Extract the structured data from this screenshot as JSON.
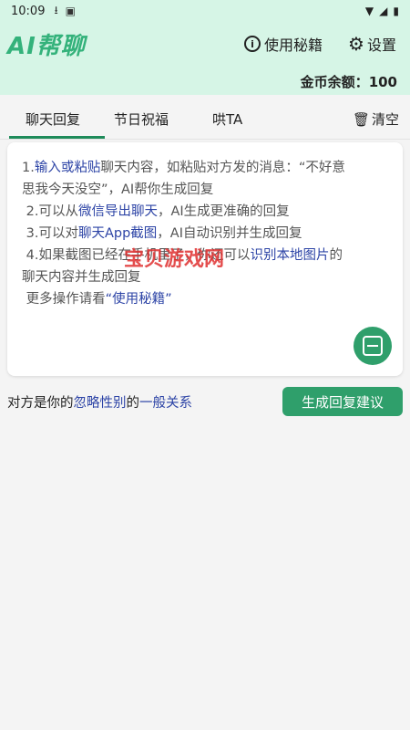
{
  "status_bar": {
    "time": "10:09",
    "icons": [
      "download-icon",
      "font-app-icon",
      "wifi-icon",
      "cellular-icon",
      "battery-icon"
    ]
  },
  "header": {
    "logo": "AI帮聊",
    "help_label": "使用秘籍",
    "settings_label": "设置",
    "coins_label": "金币余额：",
    "coins_value": "100"
  },
  "tabs": {
    "items": [
      {
        "label": "聊天回复"
      },
      {
        "label": "节日祝福"
      },
      {
        "label": "哄TA"
      }
    ],
    "active_index": 0,
    "clear_label": "清空"
  },
  "card": {
    "l1_a": "1.",
    "l1_hl": "输入或粘贴",
    "l1_b": "聊天内容，如粘贴对方发的消息：“不好意",
    "l1_c": "思我今天没空”，AI帮你生成回复",
    "l2_a": "2.可以从",
    "l2_hl": "微信导出聊天",
    "l2_b": "，AI生成更准确的回复",
    "l3_a": "3.可以对",
    "l3_hl": "聊天App截图",
    "l3_b": "，AI自动识别并生成回复",
    "l4_a": "4.如果截图已经在手机里了，你还可以",
    "l4_hl": "识别本地图片",
    "l4_b": "的",
    "l4_c": "聊天内容并生成回复",
    "l5_a": "更多操作请看",
    "l5_hl": "“使用秘籍”"
  },
  "relation": {
    "a": "对方是你的",
    "hl1": "忽略性别",
    "b": "的",
    "hl2": "一般关系"
  },
  "generate_button": "生成回复建议",
  "watermark": "宝贝游戏网",
  "colors": {
    "accent": "#2f9f6b",
    "header_bg": "#d6f5e6",
    "link": "#2d44a6"
  }
}
